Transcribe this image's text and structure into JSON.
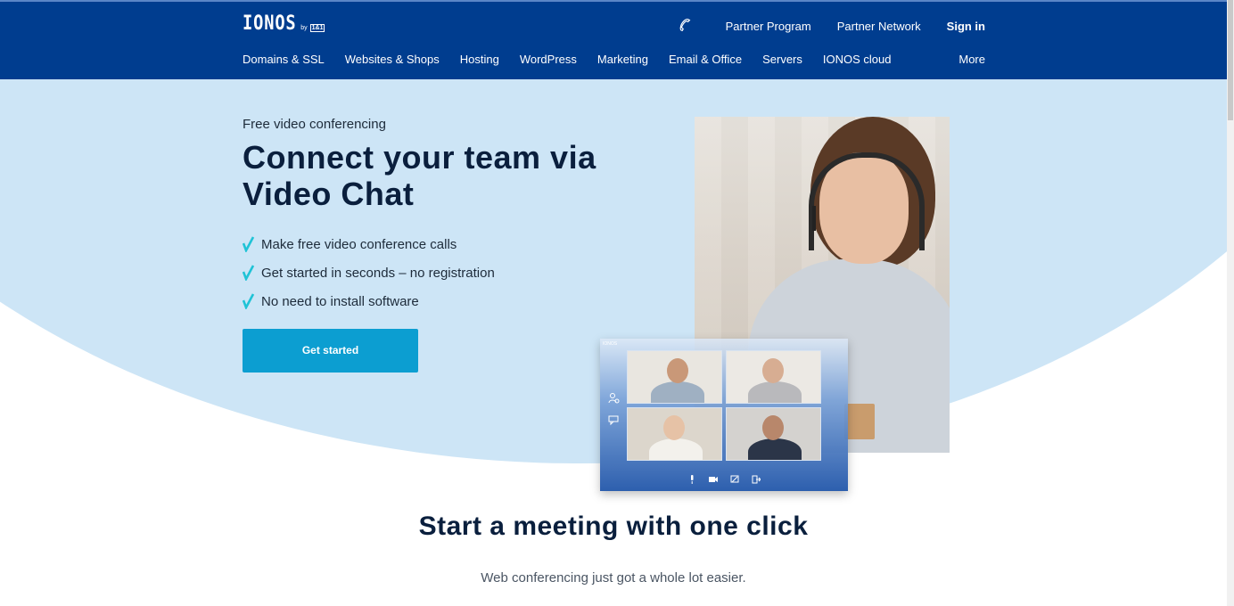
{
  "header": {
    "logo": {
      "name": "IONOS",
      "by": "by",
      "badge": "1&1"
    },
    "top_links": {
      "phone_icon": "phone-icon",
      "partner_program": "Partner Program",
      "partner_network": "Partner Network",
      "sign_in": "Sign in"
    },
    "nav": [
      {
        "label": "Domains & SSL"
      },
      {
        "label": "Websites & Shops"
      },
      {
        "label": "Hosting"
      },
      {
        "label": "WordPress"
      },
      {
        "label": "Marketing"
      },
      {
        "label": "Email & Office"
      },
      {
        "label": "Servers"
      },
      {
        "label": "IONOS cloud"
      }
    ],
    "more": "More"
  },
  "hero": {
    "eyebrow": "Free video conferencing",
    "title": "Connect your team via Video Chat",
    "features": [
      {
        "icon": "check-icon",
        "text": "Make free video conference calls"
      },
      {
        "icon": "check-icon",
        "text": "Get started in seconds – no registration"
      },
      {
        "icon": "check-icon",
        "text": "No need to install software"
      }
    ],
    "cta": "Get started",
    "conference_preview": {
      "title": "IONOS",
      "side_icons": [
        "participants-icon",
        "chat-icon"
      ],
      "controls": [
        "microphone-icon",
        "camera-icon",
        "screen-share-icon",
        "leave-icon"
      ]
    }
  },
  "section": {
    "title": "Start a meeting with one click",
    "subtitle": "Web conferencing just got a whole lot easier."
  },
  "colors": {
    "header_bg": "#003d8f",
    "hero_bg": "#cde5f6",
    "cta_bg": "#0c9ed1",
    "check": "#1fc3d6",
    "heading": "#0a1f3d"
  }
}
